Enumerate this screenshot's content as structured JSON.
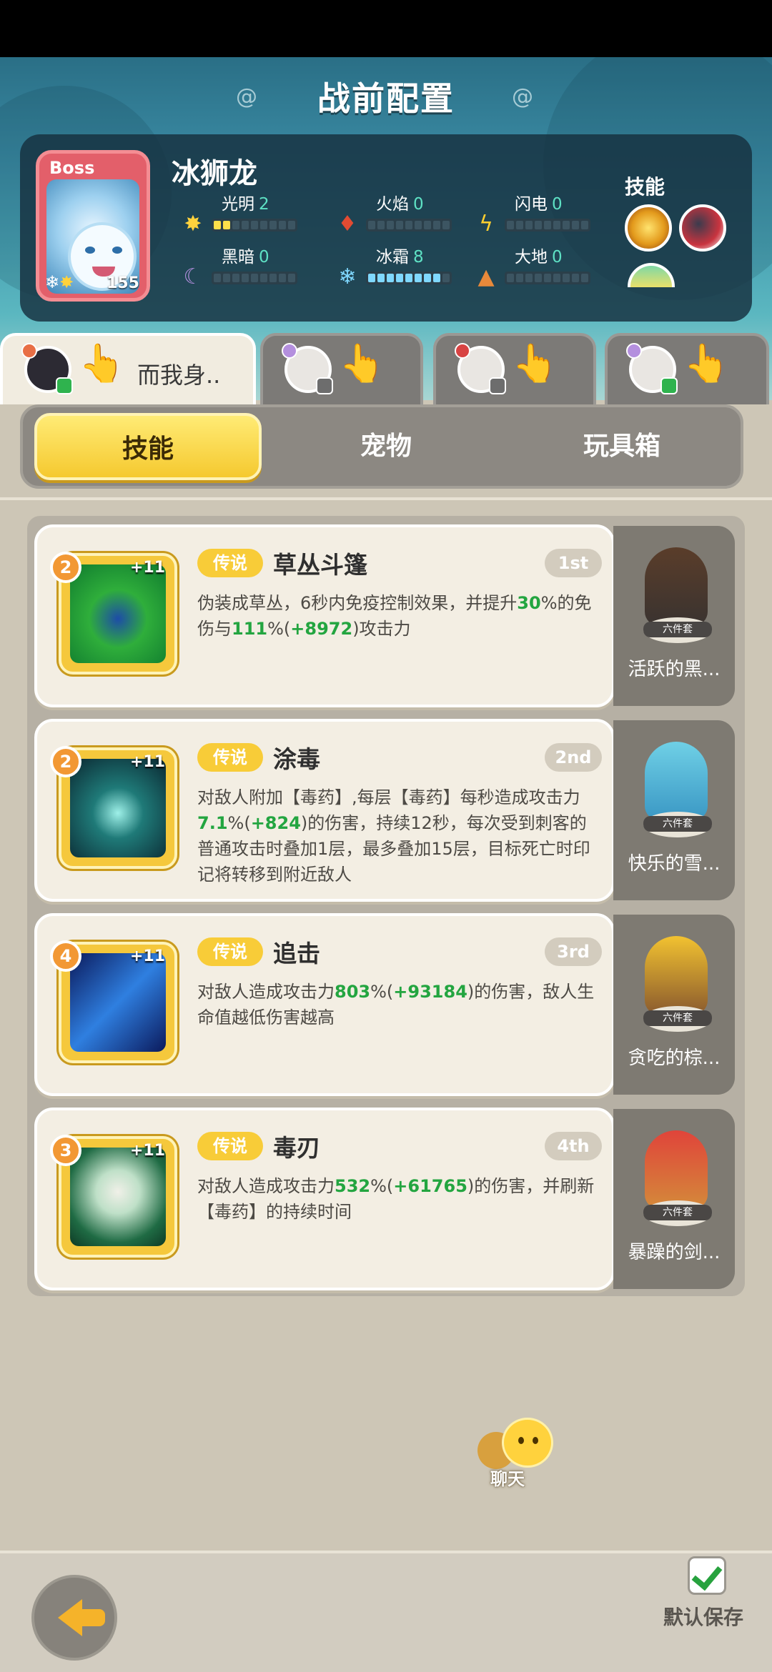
{
  "header": {
    "title": "战前配置",
    "boss": {
      "tag": "Boss",
      "name": "冰狮龙",
      "level": "155",
      "stats": [
        {
          "label": "光明",
          "value": "2",
          "icon": "sun-icon",
          "filled": 2
        },
        {
          "label": "火焰",
          "value": "0",
          "icon": "fire-icon",
          "filled": 0
        },
        {
          "label": "闪电",
          "value": "0",
          "icon": "lightning-icon",
          "filled": 0
        },
        {
          "label": "黑暗",
          "value": "0",
          "icon": "moon-icon",
          "filled": 0
        },
        {
          "label": "冰霜",
          "value": "8",
          "icon": "snowflake-icon",
          "filled": 8
        },
        {
          "label": "大地",
          "value": "0",
          "icon": "earth-icon",
          "filled": 0
        }
      ],
      "skills_label": "技能"
    }
  },
  "hero_tabs": [
    {
      "name": "而我身..",
      "active": true
    },
    {
      "name": "",
      "active": false
    },
    {
      "name": "",
      "active": false
    },
    {
      "name": "",
      "active": false
    }
  ],
  "main_tabs": [
    "技能",
    "宠物",
    "玩具箱"
  ],
  "skills": [
    {
      "level": "2",
      "plus": "+11",
      "rarity": "传说",
      "name": "草丛斗篷",
      "order": "1st",
      "desc_parts": [
        "伪装成草丛，6秒内免疫控制效果，并提升",
        "30",
        "%的免伤与",
        "111",
        "%(",
        "+8972",
        ")攻击力"
      ],
      "set_badge": "六件套",
      "set_name": "活跃的黑..."
    },
    {
      "level": "2",
      "plus": "+11",
      "rarity": "传说",
      "name": "涂毒",
      "order": "2nd",
      "desc_parts": [
        "对敌人附加【毒药】,每层【毒药】每秒造成攻击力",
        "7.1",
        "%(",
        "+824",
        ")的伤害，持续12秒，每次受到刺客的普通攻击时叠加1层，最多叠加15层，目标死亡时印记将转移到附近敌人"
      ],
      "set_badge": "六件套",
      "set_name": "快乐的雪..."
    },
    {
      "level": "4",
      "plus": "+11",
      "rarity": "传说",
      "name": "追击",
      "order": "3rd",
      "desc_parts": [
        "对敌人造成攻击力",
        "803",
        "%(",
        "+93184",
        ")的伤害，敌人生命值越低伤害越高"
      ],
      "set_badge": "六件套",
      "set_name": "贪吃的棕..."
    },
    {
      "level": "3",
      "plus": "+11",
      "rarity": "传说",
      "name": "毒刃",
      "order": "4th",
      "desc_parts": [
        "对敌人造成攻击力",
        "532",
        "%(",
        "+61765",
        ")的伤害，并刷新【毒药】的持续时间"
      ],
      "set_badge": "六件套",
      "set_name": "暴躁的剑..."
    }
  ],
  "chat": {
    "label": "聊天"
  },
  "footer": {
    "save_label": "默认保存"
  }
}
